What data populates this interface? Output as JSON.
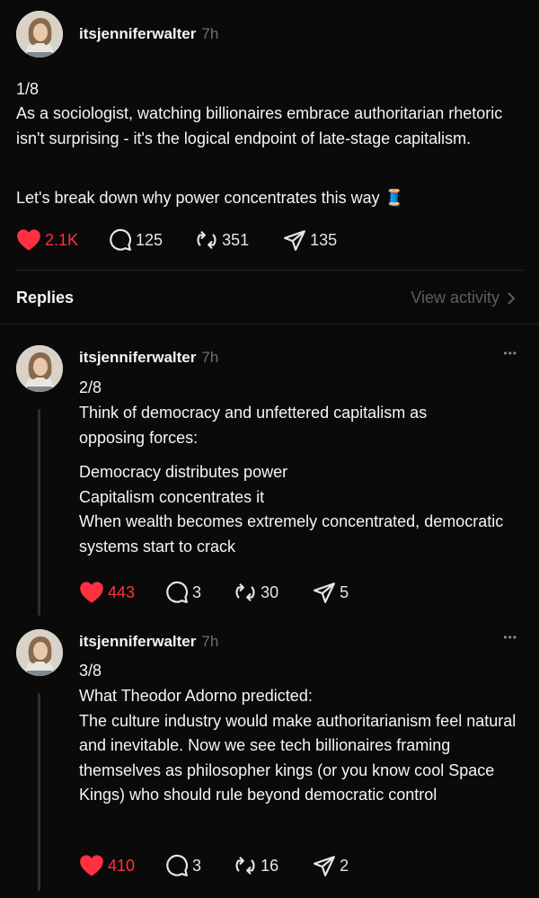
{
  "main_post": {
    "username": "itsjenniferwalter",
    "time": "7h",
    "counter": "1/8",
    "body": "As a sociologist, watching billionaires embrace authoritarian rhetoric isn't surprising - it's the logical endpoint of late-stage capitalism.",
    "body2": "Let's break down why power concentrates this way 🧵",
    "likes": "2.1K",
    "comments": "125",
    "reposts": "351",
    "shares": "135"
  },
  "replies_header": {
    "title": "Replies",
    "view_activity": "View activity"
  },
  "replies": [
    {
      "username": "itsjenniferwalter",
      "time": "7h",
      "more": "•••",
      "counter": "2/8",
      "body": "Think of democracy and unfettered capitalism as opposing forces:",
      "body2": "Democracy distributes power\nCapitalism concentrates it\nWhen wealth becomes extremely concentrated, democratic systems start to crack",
      "likes": "443",
      "comments": "3",
      "reposts": "30",
      "shares": "5"
    },
    {
      "username": "itsjenniferwalter",
      "time": "7h",
      "more": "•••",
      "counter": "3/8",
      "body": "What Theodor Adorno predicted:\nThe culture industry would make authoritarianism feel natural and inevitable. Now we see tech billionaires framing themselves as philosopher kings (or you know cool Space Kings) who should rule beyond democratic control",
      "likes": "410",
      "comments": "3",
      "reposts": "16",
      "shares": "2"
    }
  ],
  "colors": {
    "background": "#0a0a0a",
    "like": "#ff3040",
    "muted": "#6f6f6f"
  },
  "icons": [
    "heart-icon",
    "comment-icon",
    "repost-icon",
    "share-icon",
    "more-icon",
    "chevron-right-icon"
  ]
}
